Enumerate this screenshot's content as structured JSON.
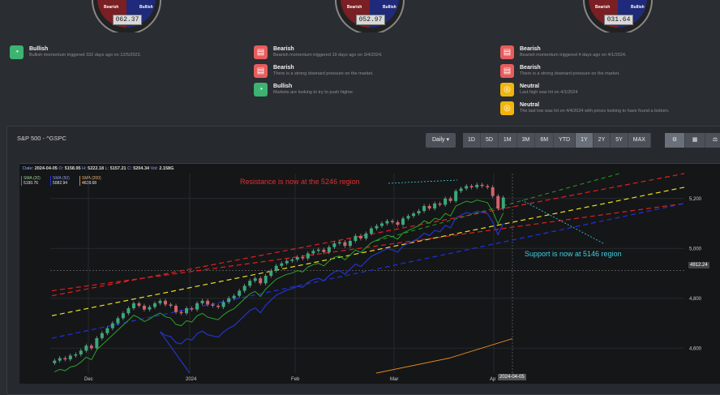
{
  "gauges": [
    {
      "bear": "Bearish",
      "bull": "Bullish",
      "value": "062.37"
    },
    {
      "bear": "Bearish",
      "bull": "Bullish",
      "value": "052.97"
    },
    {
      "bear": "Bearish",
      "bull": "Bullish",
      "value": "031.64"
    }
  ],
  "signals": [
    [
      {
        "color": "#3cb371",
        "icon": "gauge-icon",
        "title": "Bullish",
        "desc": "Bullish momentum triggered 332 days ago on 12/5/2022."
      }
    ],
    [
      {
        "color": "#e85c5c",
        "icon": "message-icon",
        "title": "Bearish",
        "desc": "Bearish momentum triggered 19 days ago on 3/4/2024."
      },
      {
        "color": "#e85c5c",
        "icon": "message-icon",
        "title": "Bearish",
        "desc": "There is a strong downard pressure on the market."
      },
      {
        "color": "#3cb371",
        "icon": "gauge-icon",
        "title": "Bullish",
        "desc": "Markets are looking to try to push higher."
      }
    ],
    [
      {
        "color": "#e85c5c",
        "icon": "message-icon",
        "title": "Bearish",
        "desc": "Bearish momentum triggered 4 days ago on 4/1/2024."
      },
      {
        "color": "#e85c5c",
        "icon": "message-icon",
        "title": "Bearish",
        "desc": "There is a strong downard pressure on the market."
      },
      {
        "color": "#f2b50c",
        "icon": "coins-icon",
        "title": "Neutral",
        "desc": "Last high was hit on 4/1/2024"
      },
      {
        "color": "#f2b50c",
        "icon": "coins-icon",
        "title": "Neutral",
        "desc": "The last low was hit on 4/4/2024 with prices looking to have found a bottom."
      }
    ]
  ],
  "panel": {
    "title": "S&P 500 - ^GSPC",
    "interval": "Daily ▾",
    "ranges": [
      "1D",
      "5D",
      "1M",
      "3M",
      "6M",
      "YTD",
      "1Y",
      "2Y",
      "5Y",
      "MAX"
    ],
    "active_range": "1Y",
    "tools": [
      "settings-icon",
      "calculator-icon",
      "scale-icon"
    ]
  },
  "ohlc": {
    "date_label": "Date",
    "date": "2024-04-05",
    "o_label": "O",
    "o": "5158.95",
    "h_label": "H",
    "h": "5222.18",
    "l_label": "L",
    "l": "5157.21",
    "c_label": "C",
    "c": "5204.34",
    "vol_label": "Vol",
    "vol": "2.158G"
  },
  "sma": [
    {
      "label": "SMA (20)",
      "value": "5190.76",
      "color": "#2ea02e"
    },
    {
      "label": "SMA (50)",
      "value": "5082.94",
      "color": "#2533c9"
    },
    {
      "label": "SMA (200)",
      "value": "4638.68",
      "color": "#e08a1e"
    }
  ],
  "annotations": {
    "resistance": "Resistance is now at the 5246 region",
    "support": "Support is now at 5146 region"
  },
  "chart_data": {
    "type": "candlestick",
    "y_ticks": [
      "5,200",
      "5,000",
      "4,800",
      "4,600"
    ],
    "y_tick_values": [
      5200,
      5000,
      4800,
      4600
    ],
    "x_ticks": [
      "Dec",
      "2024",
      "Feb",
      "Mar",
      "Ap"
    ],
    "crosshair_price": "4912.24",
    "crosshair_date": "2024-04-05",
    "ylim": [
      4500,
      5300
    ],
    "closes": [
      4550,
      4560,
      4555,
      4570,
      4575,
      4590,
      4610,
      4600,
      4640,
      4660,
      4680,
      4700,
      4720,
      4740,
      4760,
      4780,
      4770,
      4755,
      4765,
      4780,
      4790,
      4775,
      4770,
      4745,
      4740,
      4760,
      4755,
      4780,
      4790,
      4775,
      4770,
      4765,
      4785,
      4800,
      4810,
      4830,
      4850,
      4870,
      4880,
      4860,
      4890,
      4910,
      4930,
      4940,
      4950,
      4955,
      4965,
      4960,
      4980,
      4990,
      4995,
      4985,
      5005,
      5020,
      5025,
      5010,
      5030,
      5050,
      5040,
      5060,
      5080,
      5090,
      5100,
      5110,
      5105,
      5095,
      5120,
      5130,
      5140,
      5150,
      5170,
      5160,
      5180,
      5175,
      5200,
      5190,
      5230,
      5240,
      5250,
      5245,
      5255,
      5250,
      5245,
      5210,
      5160,
      5204
    ]
  }
}
